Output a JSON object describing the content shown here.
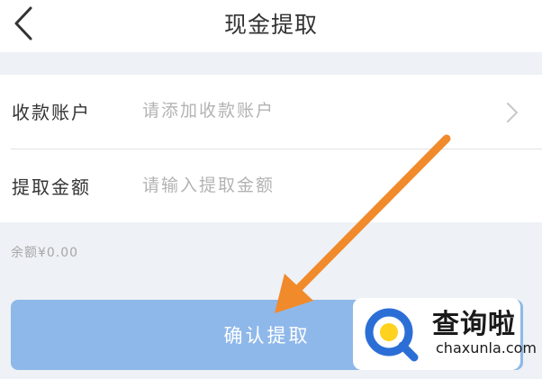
{
  "header": {
    "title": "现金提取",
    "back_icon": "chevron-left-icon"
  },
  "form": {
    "account_row": {
      "label": "收款账户",
      "placeholder": "请添加收款账户",
      "icon": "chevron-right-icon"
    },
    "amount_row": {
      "label": "提取金额",
      "placeholder": "请输入提取金额"
    }
  },
  "balance": {
    "text": "余额¥0.00"
  },
  "actions": {
    "confirm_label": "确认提取"
  },
  "overlay": {
    "arrow_color": "#f08a2b"
  },
  "watermark": {
    "name_cn": "查询啦",
    "domain": "chaxunla.com"
  },
  "colors": {
    "button_bg": "#8fb8ea",
    "page_bg": "#eef1f5",
    "text_primary": "#333333",
    "placeholder": "#b3b3b3",
    "watermark_accent": "#2b6fd6"
  }
}
